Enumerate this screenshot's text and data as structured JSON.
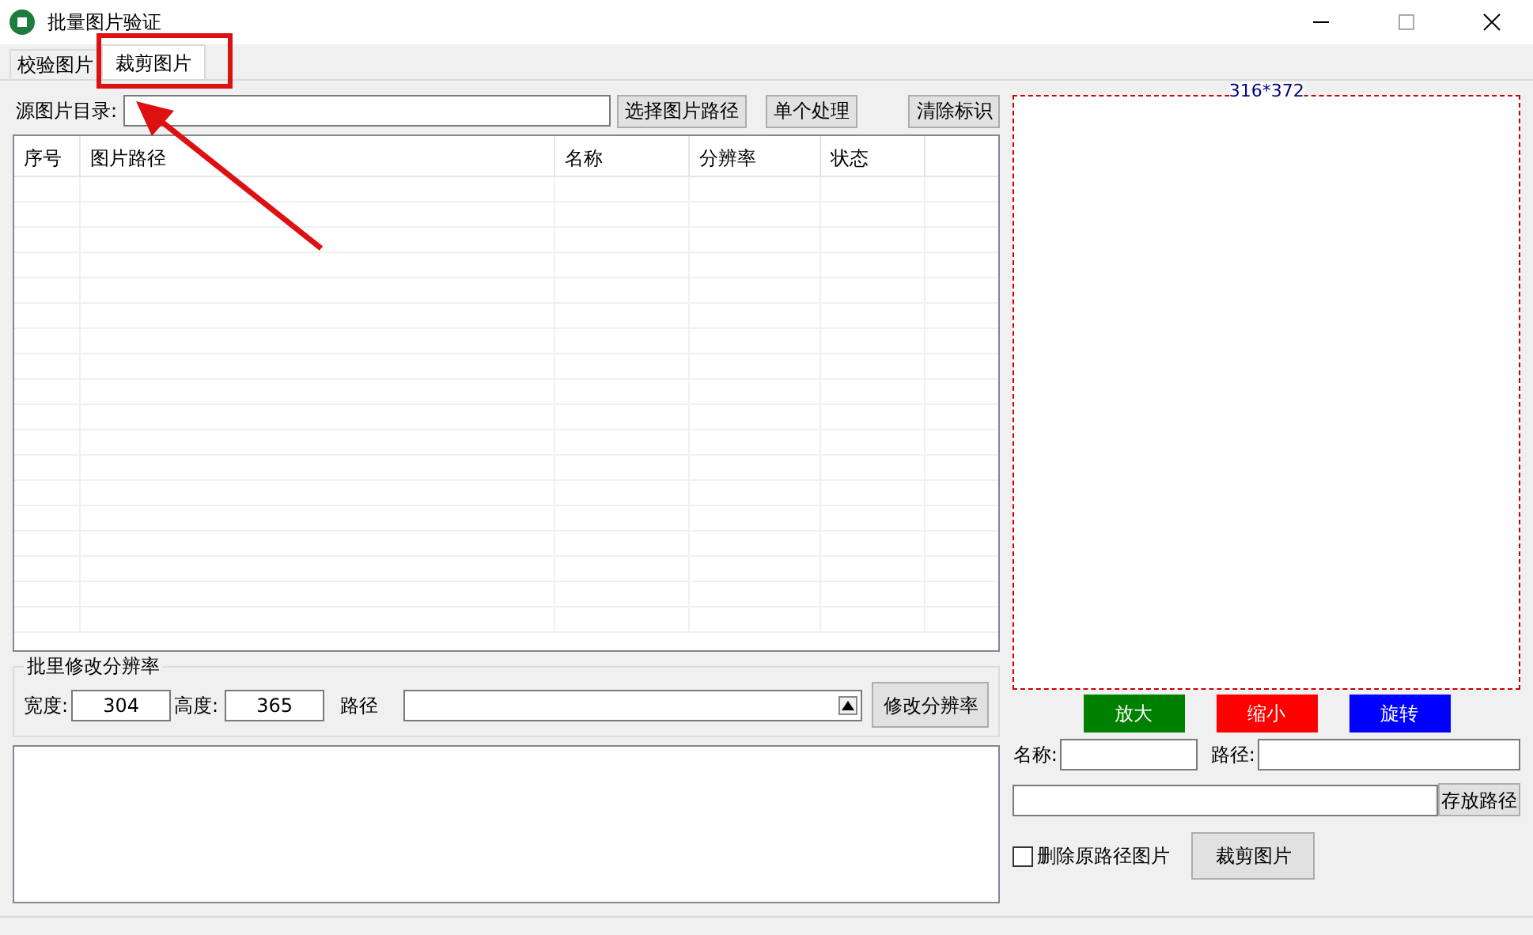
{
  "window": {
    "title": "批量图片验证"
  },
  "tabs": [
    {
      "label": "校验图片",
      "selected": false
    },
    {
      "label": "裁剪图片",
      "selected": true
    }
  ],
  "source": {
    "label": "源图片目录:",
    "buttons": [
      "选择图片路径",
      "单个处理",
      "清除标识"
    ]
  },
  "table": {
    "columns": [
      "序号",
      "图片路径",
      "名称",
      "分辨率",
      "状态"
    ]
  },
  "batch": {
    "title": "批里修改分辨率",
    "width_label": "宽度:",
    "width_value": "304",
    "height_label": "高度:",
    "height_value": "365",
    "path_label": "路径",
    "button": "修改分辨率"
  },
  "preview": {
    "size": "316*372",
    "buttons": [
      {
        "label": "放大",
        "color": "#008000"
      },
      {
        "label": "缩小",
        "color": "#ff0000"
      },
      {
        "label": "旋转",
        "color": "#0000ff"
      }
    ]
  },
  "save": {
    "name_label": "名称:",
    "path_label": "路径:",
    "store_button": "存放路径",
    "delete_checkbox": {
      "label": "删除原路径图片",
      "checked": false
    },
    "crop_button": "裁剪图片"
  }
}
